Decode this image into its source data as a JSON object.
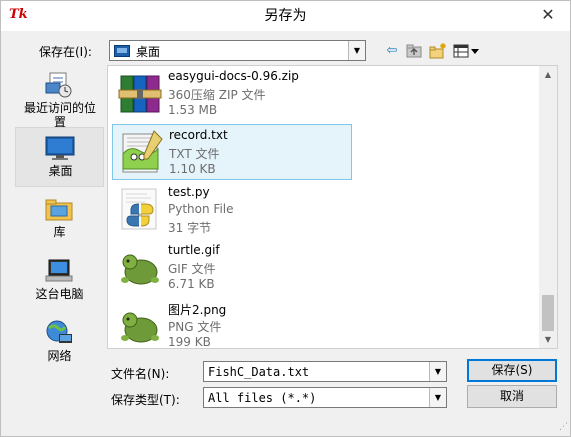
{
  "window": {
    "title": "另存为",
    "close_glyph": "✕",
    "app_icon_text": "Tk"
  },
  "location": {
    "label": "保存在(I):",
    "value": "桌面"
  },
  "places": [
    {
      "label": "最近访问的位置",
      "icon": "recent-places-icon"
    },
    {
      "label": "桌面",
      "icon": "desktop-icon",
      "selected": true
    },
    {
      "label": "库",
      "icon": "library-icon"
    },
    {
      "label": "这台电脑",
      "icon": "computer-icon"
    },
    {
      "label": "网络",
      "icon": "network-icon"
    }
  ],
  "files": [
    {
      "name": "easygui-docs-0.96.zip",
      "type": "360压缩 ZIP 文件",
      "size": "1.53 MB",
      "icon": "zip-archive-icon"
    },
    {
      "name": "record.txt",
      "type": "TXT 文件",
      "size": "1.10 KB",
      "icon": "text-file-icon",
      "selected": true
    },
    {
      "name": "test.py",
      "type": "Python File",
      "size": "31 字节",
      "icon": "python-file-icon"
    },
    {
      "name": "turtle.gif",
      "type": "GIF 文件",
      "size": "6.71 KB",
      "icon": "gif-image-icon"
    },
    {
      "name": "图片2.png",
      "type": "PNG 文件",
      "size": "199 KB",
      "icon": "png-image-icon"
    }
  ],
  "filename": {
    "label": "文件名(N):",
    "value": "FishC_Data.txt"
  },
  "filetype": {
    "label": "保存类型(T):",
    "value": "All files (*.*)"
  },
  "buttons": {
    "save": "保存(S)",
    "cancel": "取消"
  },
  "colors": {
    "selection_bg": "#e5f3fb",
    "selection_border": "#7fc6e8",
    "default_button_border": "#0078d7"
  }
}
